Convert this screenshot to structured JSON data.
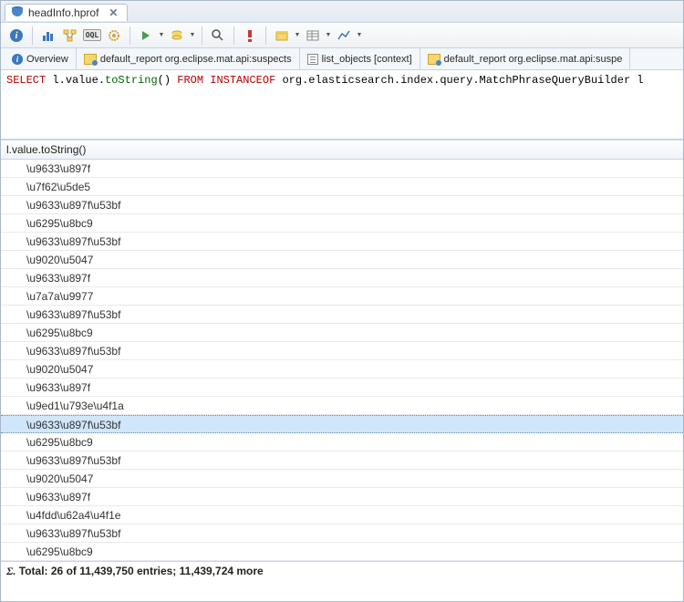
{
  "title_tab": {
    "label": "headInfo.hprof"
  },
  "toolbar": {
    "info": "i"
  },
  "subtabs": {
    "overview": "Overview",
    "report1": "default_report  org.eclipse.mat.api:suspects",
    "list_obj": "list_objects [context]",
    "report2": "default_report  org.eclipse.mat.api:suspe"
  },
  "query": {
    "select": "SELECT",
    "expr_left": "l.value.",
    "method": "toString",
    "parens": "()",
    "from": "FROM INSTANCEOF",
    "cls": "org.elasticsearch.index.query.MatchPhraseQueryBuilder l"
  },
  "header": "l.value.toString()",
  "rows": [
    "\\u9633\\u897f",
    "\\u7f62\\u5de5",
    "\\u9633\\u897f\\u53bf",
    "\\u6295\\u8bc9",
    "\\u9633\\u897f\\u53bf",
    "\\u9020\\u5047",
    "\\u9633\\u897f",
    "\\u7a7a\\u9977",
    "\\u9633\\u897f\\u53bf",
    "\\u6295\\u8bc9",
    "\\u9633\\u897f\\u53bf",
    "\\u9020\\u5047",
    "\\u9633\\u897f",
    "\\u9ed1\\u793e\\u4f1a",
    "\\u9633\\u897f\\u53bf",
    "\\u6295\\u8bc9",
    "\\u9633\\u897f\\u53bf",
    "\\u9020\\u5047",
    "\\u9633\\u897f",
    "\\u4fdd\\u62a4\\u4f1e",
    "\\u9633\\u897f\\u53bf",
    "\\u6295\\u8bc9"
  ],
  "selected_index": 14,
  "total": "Total: 26 of 11,439,750 entries; 11,439,724 more"
}
